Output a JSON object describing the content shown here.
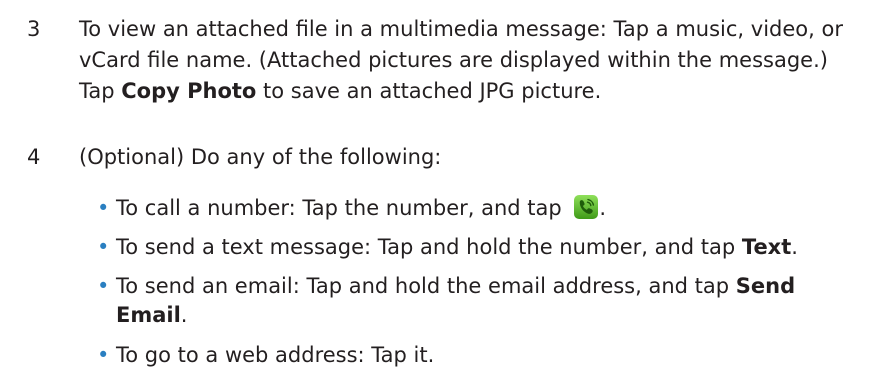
{
  "step3": {
    "number": "3",
    "text_before": "To view an attached file in a multimedia message: Tap a music, video, or vCard file name. (Attached pictures are displayed within the message.) Tap ",
    "bold": "Copy Photo",
    "text_after": " to save an attached JPG picture."
  },
  "step4": {
    "number": "4",
    "text": "(Optional) Do any of the following:"
  },
  "bullets": {
    "call": {
      "text": "To call a number: Tap the number, and tap ",
      "end": ".",
      "icon": "phone-call-icon"
    },
    "sms": {
      "text": "To send a text message: Tap and hold the number, and tap ",
      "bold": "Text",
      "end": "."
    },
    "email": {
      "text": "To send an email: Tap and hold the email address, and tap ",
      "bold": "Send Email",
      "end": "."
    },
    "web": {
      "text": "To go to a web address: Tap it."
    },
    "bullet_char": "•"
  },
  "colors": {
    "text": "#231f20",
    "bullet": "#2a7fc1",
    "icon_green": "#5bbf2a",
    "icon_dark": "#2f7a12"
  }
}
